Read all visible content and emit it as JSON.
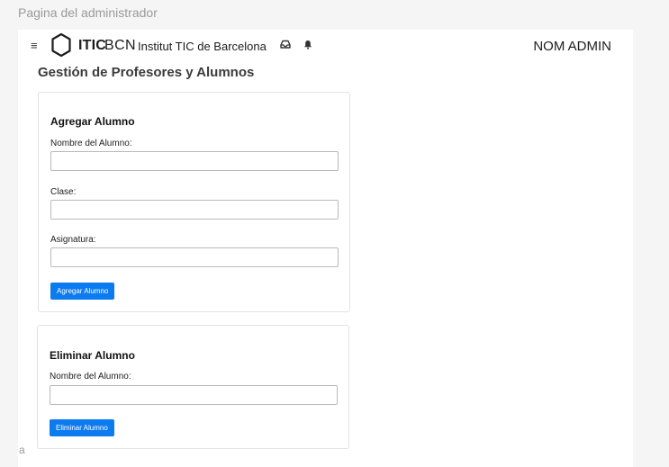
{
  "page_caption": "Pagina del administrador",
  "header": {
    "menu_icon": "hamburger-menu-icon",
    "logo_icon": "hexagon-logo-icon",
    "brand_bold": "ITIC",
    "brand_light": "BCN",
    "brand_name": "Institut TIC de Barcelona",
    "icons": [
      "inbox-icon",
      "bell-icon"
    ],
    "user_name": "NOM ADMIN"
  },
  "main": {
    "title": "Gestión de Profesores y Alumnos",
    "add_form": {
      "heading": "Agregar Alumno",
      "fields": [
        {
          "label": "Nombre del Alumno:",
          "value": "",
          "placeholder": ""
        },
        {
          "label": "Clase:",
          "value": "",
          "placeholder": ""
        },
        {
          "label": "Asignatura:",
          "value": "",
          "placeholder": ""
        }
      ],
      "submit_label": "Agregar Alumno"
    },
    "delete_form": {
      "heading": "Eliminar Alumno",
      "fields": [
        {
          "label": "Nombre del Alumno:",
          "value": "",
          "placeholder": ""
        }
      ],
      "submit_label": "Eliminar Alumno"
    }
  },
  "footer_char": "a",
  "colors": {
    "background": "#f5f5f5",
    "surface": "#ffffff",
    "primary_button": "#0d7bf0",
    "caption_text": "#9a9a9a"
  }
}
